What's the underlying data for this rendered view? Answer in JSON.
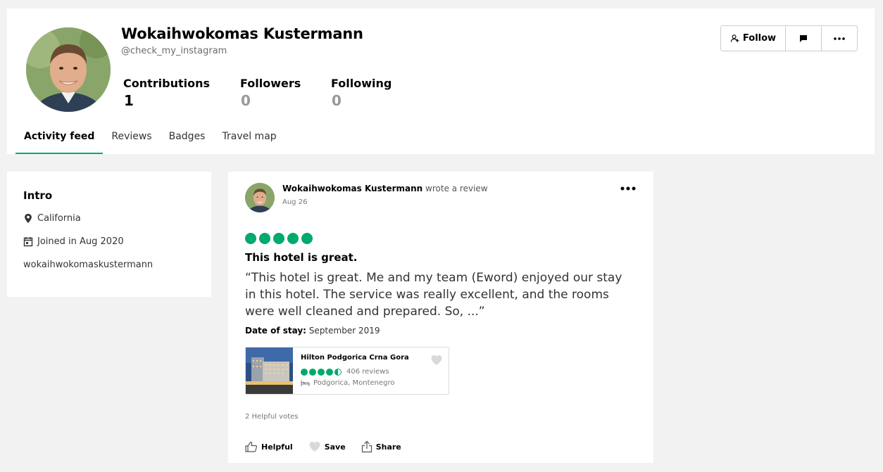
{
  "profile": {
    "name": "Wokaihwokomas Kustermann",
    "handle": "@check_my_instagram",
    "stats": [
      {
        "label": "Contributions",
        "value": "1"
      },
      {
        "label": "Followers",
        "value": "0"
      },
      {
        "label": "Following",
        "value": "0"
      }
    ],
    "actions": {
      "follow_label": "Follow",
      "message_icon": "message-icon",
      "more_icon": "more-icon"
    }
  },
  "tabs": [
    {
      "label": "Activity feed",
      "active": true
    },
    {
      "label": "Reviews",
      "active": false
    },
    {
      "label": "Badges",
      "active": false
    },
    {
      "label": "Travel map",
      "active": false
    }
  ],
  "intro": {
    "title": "Intro",
    "location": "California",
    "joined": "Joined in Aug 2020",
    "website": "wokaihwokomaskustermann"
  },
  "review": {
    "author": "Wokaihwokomas Kustermann",
    "action_text": "wrote a review",
    "date": "Aug 26",
    "rating": 5,
    "title": "This hotel is great.",
    "text": "“This hotel is great. Me and my team (Eword) enjoyed our stay in this hotel. The service was really excellent, and the rooms were well cleaned and prepared. So, ...”",
    "date_of_stay_label": "Date of stay:",
    "date_of_stay_value": "September 2019",
    "hotel": {
      "name": "Hilton Podgorica Crna Gora",
      "rating": 4.5,
      "reviews": "406 reviews",
      "location": "Podgorica, Montenegro"
    },
    "helpful_votes": "2 Helpful votes",
    "actions": {
      "helpful": "Helpful",
      "save": "Save",
      "share": "Share"
    }
  },
  "colors": {
    "accent": "#00aa6c",
    "background": "#f2f2f2",
    "muted": "#6b6b6b"
  }
}
